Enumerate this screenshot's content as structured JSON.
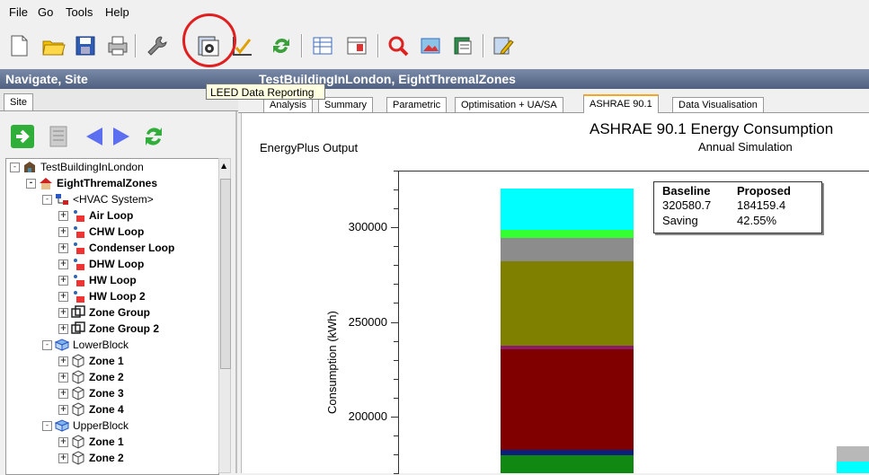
{
  "menu": [
    "File",
    "Go",
    "Tools",
    "Help"
  ],
  "toolbar": {
    "tooltip": "LEED Data Reporting",
    "icons": [
      "new-file-icon",
      "open-folder-icon",
      "save-icon",
      "print-icon",
      "wrench-icon",
      "leed-report-icon",
      "chart-check-icon",
      "refresh-icon",
      "grid-icon",
      "table-icon",
      "search-icon",
      "image-tools-icon",
      "database-icon",
      "edit-icon"
    ]
  },
  "header": {
    "left_title": "Navigate, Site",
    "main_title": "TestBuildingInLondon, EightThremalZones"
  },
  "left_tabs": [
    "Site"
  ],
  "main_tabs": [
    "Analysis",
    "Summary",
    "Parametric",
    "Optimisation + UA/SA",
    "ASHRAE 90.1",
    "Data Visualisation"
  ],
  "active_tab": "ASHRAE 90.1",
  "tree": [
    {
      "label": "TestBuildingInLondon",
      "bold": false,
      "icon": "building-icon",
      "expander": "-"
    },
    {
      "label": "EightThremalZones",
      "bold": true,
      "icon": "house-icon",
      "expander": "-"
    },
    {
      "label": "<HVAC System>",
      "bold": false,
      "icon": "hvac-icon",
      "expander": "-"
    },
    {
      "label": "Air Loop",
      "bold": true,
      "icon": "loop-icon",
      "expander": "+"
    },
    {
      "label": "CHW Loop",
      "bold": true,
      "icon": "loop-icon",
      "expander": "+"
    },
    {
      "label": "Condenser Loop",
      "bold": true,
      "icon": "loop-icon",
      "expander": "+"
    },
    {
      "label": "DHW Loop",
      "bold": true,
      "icon": "loop-icon",
      "expander": "+"
    },
    {
      "label": "HW Loop",
      "bold": true,
      "icon": "loop-icon",
      "expander": "+"
    },
    {
      "label": "HW Loop 2",
      "bold": true,
      "icon": "loop-icon",
      "expander": "+"
    },
    {
      "label": "Zone Group",
      "bold": true,
      "icon": "zone-group-icon",
      "expander": "+"
    },
    {
      "label": "Zone Group 2",
      "bold": true,
      "icon": "zone-group-icon",
      "expander": "+"
    },
    {
      "label": "LowerBlock",
      "bold": false,
      "icon": "block-icon",
      "expander": "-"
    },
    {
      "label": "Zone 1",
      "bold": true,
      "icon": "zone-icon",
      "expander": "+"
    },
    {
      "label": "Zone 2",
      "bold": true,
      "icon": "zone-icon",
      "expander": "+"
    },
    {
      "label": "Zone 3",
      "bold": true,
      "icon": "zone-icon",
      "expander": "+"
    },
    {
      "label": "Zone 4",
      "bold": true,
      "icon": "zone-icon",
      "expander": "+"
    },
    {
      "label": "UpperBlock",
      "bold": false,
      "icon": "block-icon",
      "expander": "-"
    },
    {
      "label": "Zone 1",
      "bold": true,
      "icon": "zone-icon",
      "expander": "+"
    },
    {
      "label": "Zone 2",
      "bold": true,
      "icon": "zone-icon",
      "expander": "+"
    }
  ],
  "chart_data": {
    "type": "bar",
    "title": "ASHRAE 90.1 Energy Consumption",
    "subtitle": "Annual Simulation",
    "source_label": "EnergyPlus Output",
    "ylabel": "Consumption (kWh)",
    "ylim": [
      170000,
      330000
    ],
    "yticks": [
      200000,
      250000,
      300000
    ],
    "ytick_labels": [
      "200000",
      "250000",
      "300000"
    ],
    "stacked": true,
    "bars": [
      {
        "name": "Baseline",
        "segments": [
          {
            "from": 170000,
            "to": 179500,
            "color": "#118811"
          },
          {
            "from": 179500,
            "to": 182500,
            "color": "#0c1f7a"
          },
          {
            "from": 182500,
            "to": 235500,
            "color": "#800000"
          },
          {
            "from": 235500,
            "to": 237500,
            "color": "#8b1a6b"
          },
          {
            "from": 237500,
            "to": 282000,
            "color": "#808000"
          },
          {
            "from": 282000,
            "to": 294500,
            "color": "#8c8c8c"
          },
          {
            "from": 294500,
            "to": 298500,
            "color": "#33ff33"
          },
          {
            "from": 298500,
            "to": 320580.7,
            "color": "#00ffff"
          }
        ]
      },
      {
        "name": "Proposed",
        "segments": [
          {
            "from": 170000,
            "to": 176000,
            "color": "#00ffff"
          },
          {
            "from": 176000,
            "to": 184159.4,
            "color": "#b8b8b8"
          }
        ]
      }
    ],
    "legend": {
      "headers": [
        "Baseline",
        "Proposed"
      ],
      "values": [
        "320580.7",
        "184159.4"
      ],
      "saving_label": "Saving",
      "saving_value": "42.55%"
    }
  }
}
